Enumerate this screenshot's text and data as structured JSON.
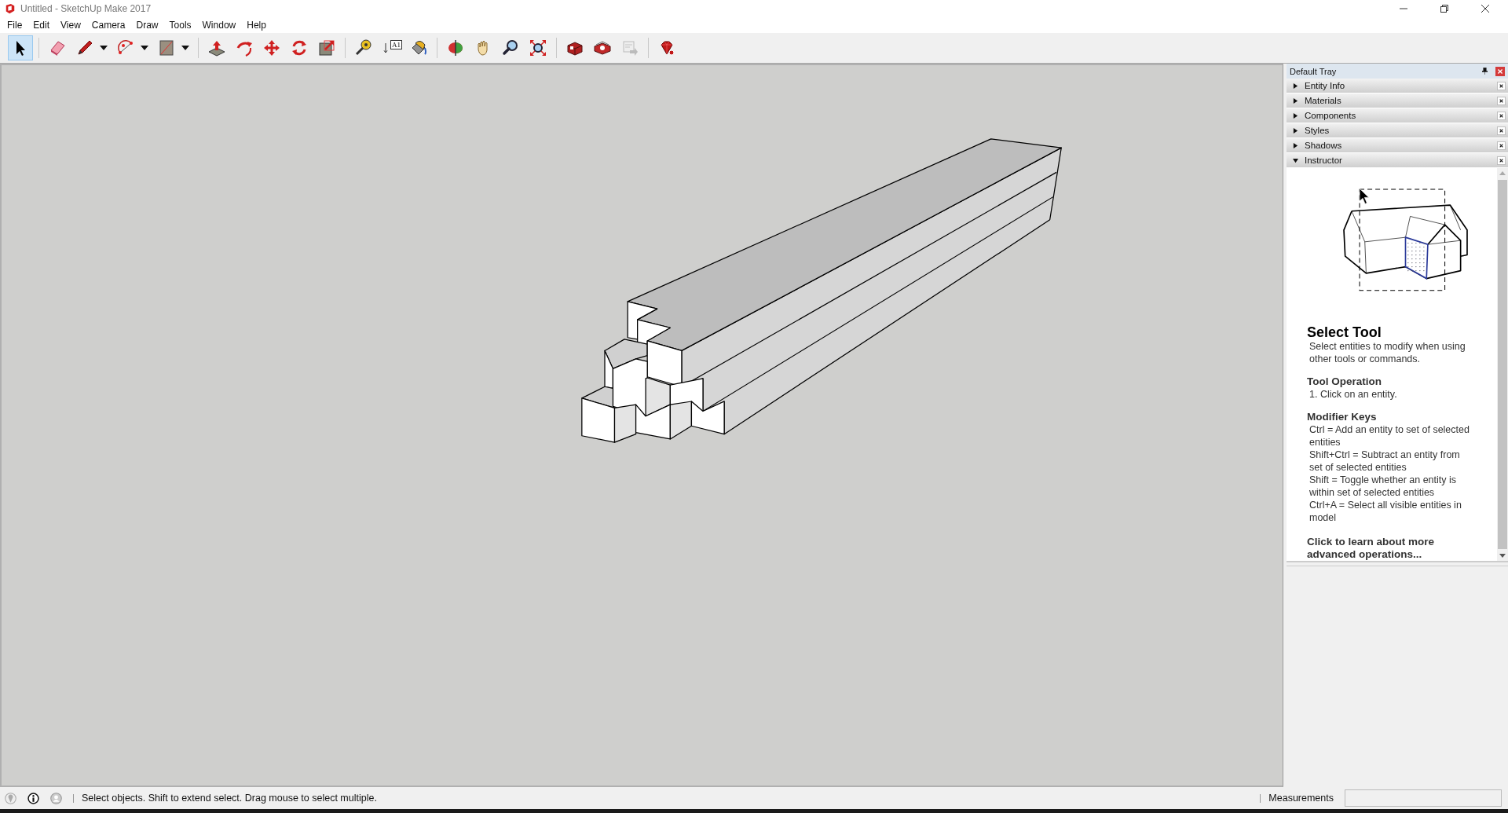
{
  "window": {
    "title": "Untitled - SketchUp Make 2017"
  },
  "menu": [
    "File",
    "Edit",
    "View",
    "Camera",
    "Draw",
    "Tools",
    "Window",
    "Help"
  ],
  "toolbar": {
    "groups": [
      [
        {
          "selected": true,
          "disabled": false
        }
      ],
      [
        {
          "selected": false,
          "disabled": false
        },
        {
          "selected": false,
          "disabled": false,
          "dropdown": true
        },
        {
          "selected": false,
          "disabled": false,
          "dropdown": true
        },
        {
          "selected": false,
          "disabled": false,
          "dropdown": true
        }
      ],
      [
        {
          "selected": false,
          "disabled": false
        },
        {
          "selected": false,
          "disabled": false
        },
        {
          "selected": false,
          "disabled": false
        },
        {
          "selected": false,
          "disabled": false
        },
        {
          "selected": false,
          "disabled": false
        }
      ],
      [
        {
          "selected": false,
          "disabled": false
        },
        {
          "selected": false,
          "disabled": false,
          "label": "A1"
        },
        {
          "selected": false,
          "disabled": false
        }
      ],
      [
        {
          "selected": false,
          "disabled": false
        },
        {
          "selected": false,
          "disabled": false
        },
        {
          "selected": false,
          "disabled": false
        },
        {
          "selected": false,
          "disabled": false
        }
      ],
      [
        {
          "selected": false,
          "disabled": false
        },
        {
          "selected": false,
          "disabled": false
        },
        {
          "selected": false,
          "disabled": true
        }
      ],
      [
        {
          "selected": false,
          "disabled": false
        }
      ]
    ]
  },
  "tray": {
    "title": "Default Tray",
    "panels": [
      {
        "name": "Entity Info",
        "expanded": false
      },
      {
        "name": "Materials",
        "expanded": false
      },
      {
        "name": "Components",
        "expanded": false
      },
      {
        "name": "Styles",
        "expanded": false
      },
      {
        "name": "Shadows",
        "expanded": false
      },
      {
        "name": "Instructor",
        "expanded": true
      }
    ],
    "instructor": {
      "heading": "Select Tool",
      "description": "Select entities to modify when using other tools or commands.",
      "sections": [
        {
          "title": "Tool Operation",
          "lines": [
            "1. Click on an entity."
          ]
        },
        {
          "title": "Modifier Keys",
          "lines": [
            "Ctrl = Add an entity to set of selected entities",
            "Shift+Ctrl = Subtract an entity from set of selected entities",
            "Shift = Toggle whether an entity is within set of selected entities",
            "Ctrl+A = Select all visible entities in model"
          ]
        }
      ],
      "link": "Click to learn about more advanced operations..."
    }
  },
  "status_bar": {
    "message": "Select objects. Shift to extend select. Drag mouse to select multiple.",
    "measurements_label": "Measurements"
  }
}
